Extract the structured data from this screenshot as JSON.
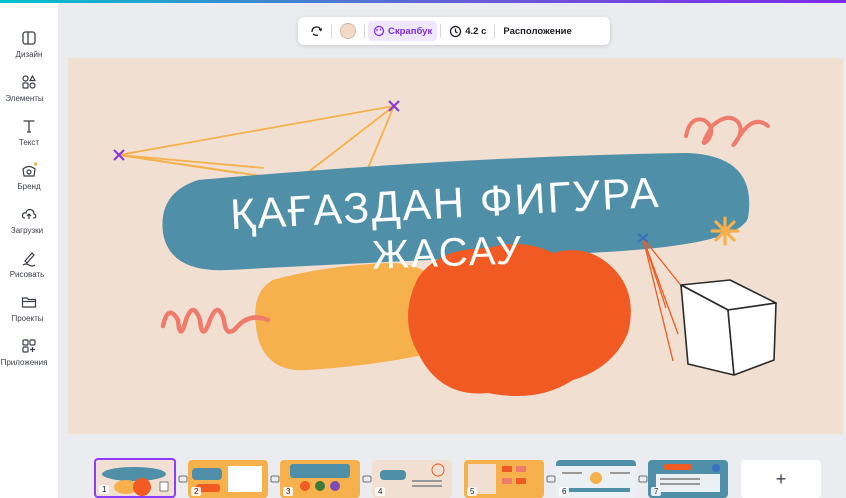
{
  "sidebar": {
    "items": [
      {
        "label": "Дизайн",
        "icon": "layout-icon"
      },
      {
        "label": "Элементы",
        "icon": "elements-icon"
      },
      {
        "label": "Текст",
        "icon": "text-icon"
      },
      {
        "label": "Бренд",
        "icon": "brand-icon"
      },
      {
        "label": "Загрузки",
        "icon": "upload-cloud-icon"
      },
      {
        "label": "Рисовать",
        "icon": "draw-pen-icon"
      },
      {
        "label": "Проекты",
        "icon": "folder-icon"
      },
      {
        "label": "Приложения",
        "icon": "apps-icon"
      }
    ]
  },
  "toolbar": {
    "color_swatch": "#f4d9c7",
    "style_label": "Скрапбук",
    "duration_label": "4.2 с",
    "position_label": "Расположение"
  },
  "slide": {
    "title_line1": "ҚАҒАЗДАН ФИГУРА",
    "title_line2": "ЖАСАУ",
    "background": "#f1dfd1",
    "accent_blue": "#4f8fa8",
    "accent_orange": "#f15a22",
    "accent_yellow": "#f6b04c",
    "accent_pink": "#ef7b6c"
  },
  "filmstrip": {
    "pages": [
      {
        "num": "1"
      },
      {
        "num": "2"
      },
      {
        "num": "3"
      },
      {
        "num": "4"
      },
      {
        "num": "5"
      },
      {
        "num": "6"
      },
      {
        "num": "7"
      }
    ],
    "add_label": "+"
  }
}
